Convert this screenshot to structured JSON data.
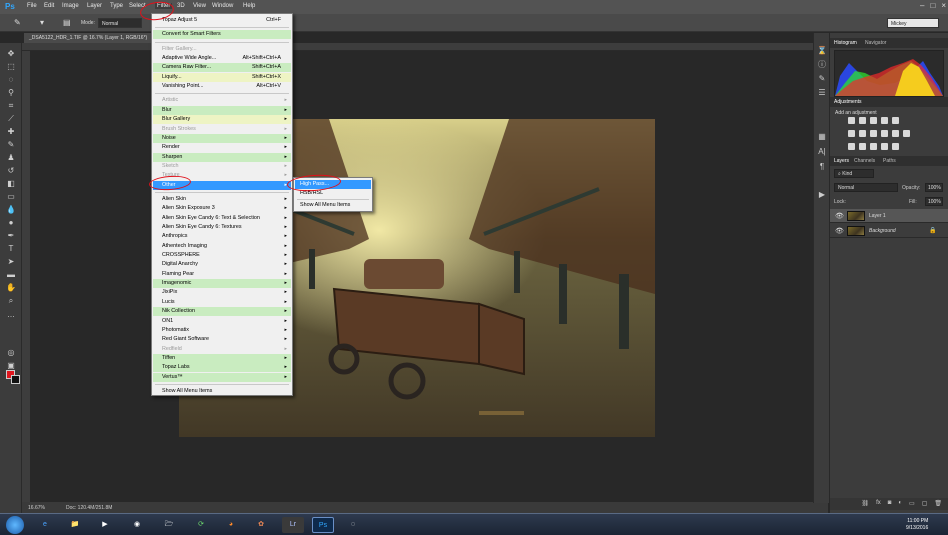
{
  "app": {
    "logo": "Ps"
  },
  "menubar": [
    "File",
    "Edit",
    "Image",
    "Layer",
    "Type",
    "Select",
    "Filter",
    "3D",
    "View",
    "Window",
    "Help"
  ],
  "options": {
    "mode_label": "Mode:",
    "mode_value": "Normal",
    "workspace": "Mickey"
  },
  "document_tab": "_DSA5122_HDR_1.TIF @ 16.7% (Layer 1, RGB/16*)",
  "status": {
    "zoom": "16.67%",
    "doc": "Doc: 120.4M/251.8M"
  },
  "filter_menu": {
    "items": [
      {
        "label": "Topaz Adjust 5",
        "shortcut": "Ctrl+F",
        "style": "",
        "arrow": false
      },
      {
        "sep": true
      },
      {
        "label": "Convert for Smart Filters",
        "style": "g",
        "arrow": false
      },
      {
        "sep": true
      },
      {
        "label": "Filter Gallery...",
        "style": "dis",
        "arrow": false
      },
      {
        "label": "Adaptive Wide Angle...",
        "shortcut": "Alt+Shift+Ctrl+A",
        "style": "",
        "arrow": false
      },
      {
        "label": "Camera Raw Filter...",
        "shortcut": "Shift+Ctrl+A",
        "style": "g",
        "arrow": false
      },
      {
        "label": "Liquify...",
        "shortcut": "Shift+Ctrl+X",
        "style": "y",
        "arrow": false
      },
      {
        "label": "Vanishing Point...",
        "shortcut": "Alt+Ctrl+V",
        "style": "",
        "arrow": false
      },
      {
        "sep": true
      },
      {
        "label": "Artistic",
        "style": "dis",
        "arrow": true
      },
      {
        "label": "Blur",
        "style": "g",
        "arrow": true
      },
      {
        "label": "Blur Gallery",
        "style": "y",
        "arrow": true
      },
      {
        "label": "Brush Strokes",
        "style": "dis",
        "arrow": true
      },
      {
        "label": "Noise",
        "style": "g",
        "arrow": true
      },
      {
        "label": "Render",
        "style": "",
        "arrow": true
      },
      {
        "label": "Sharpen",
        "style": "g",
        "arrow": true
      },
      {
        "label": "Sketch",
        "style": "dis",
        "arrow": true
      },
      {
        "label": "Texture",
        "style": "dis",
        "arrow": true
      },
      {
        "label": "Other",
        "style": "hl",
        "arrow": true
      },
      {
        "sep": true
      },
      {
        "label": "Alien Skin",
        "style": "",
        "arrow": true
      },
      {
        "label": "Alien Skin Exposure 3",
        "style": "",
        "arrow": true
      },
      {
        "label": "Alien Skin Eye Candy 6: Text & Selection",
        "style": "",
        "arrow": true
      },
      {
        "label": "Alien Skin Eye Candy 6: Textures",
        "style": "",
        "arrow": true
      },
      {
        "label": "Anthropics",
        "style": "",
        "arrow": true
      },
      {
        "label": "Athentech Imaging",
        "style": "",
        "arrow": true
      },
      {
        "label": "CROSSPHERE",
        "style": "",
        "arrow": true
      },
      {
        "label": "Digital Anarchy",
        "style": "",
        "arrow": true
      },
      {
        "label": "Flaming Pear",
        "style": "",
        "arrow": true
      },
      {
        "label": "Imagenomic",
        "style": "g",
        "arrow": true
      },
      {
        "label": "JixiPix",
        "style": "",
        "arrow": true
      },
      {
        "label": "Lucis",
        "style": "",
        "arrow": true
      },
      {
        "label": "Nik Collection",
        "style": "g",
        "arrow": true
      },
      {
        "label": "ON1",
        "style": "",
        "arrow": true
      },
      {
        "label": "Photomatix",
        "style": "",
        "arrow": true
      },
      {
        "label": "Red Giant Software",
        "style": "",
        "arrow": true
      },
      {
        "label": "Redfield",
        "style": "dis",
        "arrow": true
      },
      {
        "label": "Tiffen",
        "style": "g",
        "arrow": true
      },
      {
        "label": "Topaz Labs",
        "style": "g",
        "arrow": true
      },
      {
        "label": "Vertus™",
        "style": "g",
        "arrow": true
      },
      {
        "sep": true
      },
      {
        "label": "Show All Menu Items",
        "style": "",
        "arrow": false
      }
    ]
  },
  "other_submenu": [
    "High Pass...",
    "HSB/HSL",
    "Show All Menu Items"
  ],
  "panels": {
    "histogram_tab": "Histogram",
    "navigator_tab": "Navigator",
    "adjustments_tab": "Adjustments",
    "add_adjustment": "Add an adjustment",
    "layers_tab": "Layers",
    "channels_tab": "Channels",
    "paths_tab": "Paths",
    "kind": "Kind",
    "blend_mode": "Normal",
    "opacity_label": "Opacity:",
    "opacity": "100%",
    "lock_label": "Lock:",
    "fill_label": "Fill:",
    "fill": "100%",
    "layers": [
      {
        "name": "Layer 1",
        "selected": true
      },
      {
        "name": "Background",
        "selected": false
      }
    ]
  },
  "clock": {
    "time": "11:00 PM",
    "date": "9/13/2016"
  },
  "colors": {
    "accent": "#3399ff",
    "annotation": "#e0101a",
    "foreground": "#e0161e"
  }
}
